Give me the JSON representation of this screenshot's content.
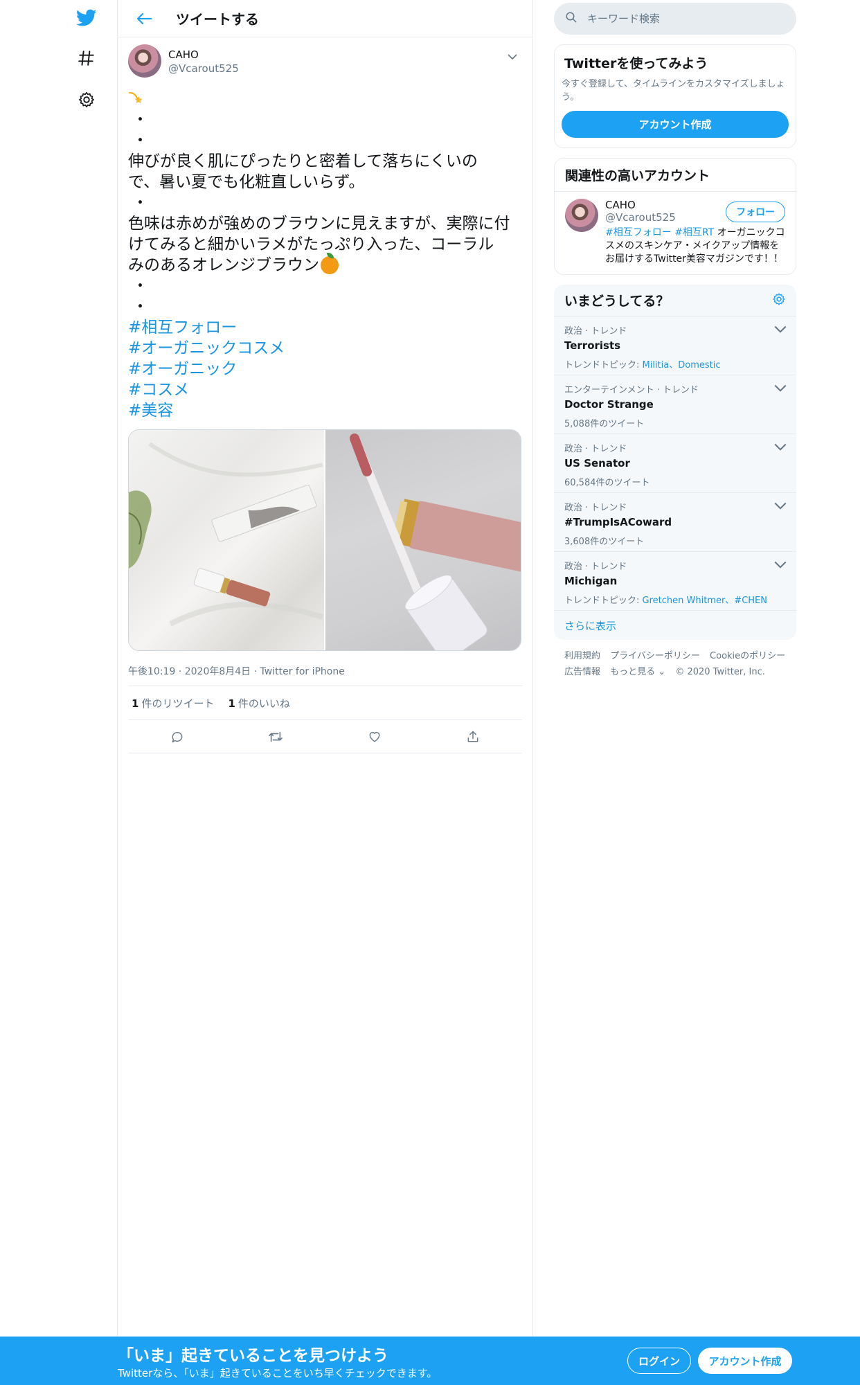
{
  "colors": {
    "brand": "#1da1f2",
    "link": "#1b95e0",
    "muted": "#657786",
    "text": "#14171a",
    "border": "#e6ecf0"
  },
  "nav": {
    "icons": [
      "twitter-logo-icon",
      "hashtag-icon",
      "gear-icon"
    ]
  },
  "header": {
    "title": "ツイートする"
  },
  "tweet": {
    "author_name": "CAHO",
    "author_handle": "@Vcarout525",
    "dot": "・",
    "line1": "伸びが良く肌にぴったりと密着して落ちにくいの",
    "line2": "で、暑い夏でも化粧直しいらず。",
    "line3": "色味は赤めが強めのブラウンに見えますが、実際に付",
    "line4": "けてみると細かいラメがたっぷり入った、コーラル",
    "line5": "みのあるオレンジブラウン",
    "hashtags": [
      "#相互フォロー",
      "#オーガニックコスメ",
      "#オーガニック",
      "#コスメ",
      "#美容"
    ],
    "meta_time": "午後10:19",
    "meta_date": "2020年8月4日",
    "meta_source": "Twitter for iPhone",
    "meta_sep": "·",
    "retweet_count": "1",
    "retweet_label": "件のリツイート",
    "like_count": "1",
    "like_label": "件のいいね"
  },
  "sidebar": {
    "search_placeholder": "キーワード検索",
    "signup": {
      "title": "Twitterを使ってみよう",
      "desc": "今すぐ登録して、タイムラインをカスタマイズしましょう。",
      "button": "アカウント作成"
    },
    "related": {
      "title": "関連性の高いアカウント",
      "name": "CAHO",
      "handle": "@Vcarout525",
      "follow": "フォロー",
      "bio_tag1": "#相互フォロー",
      "bio_tag2": "#相互RT",
      "bio_text": " オーガニックコスメのスキンケア・メイクアップ情報をお届けするTwitter美容マガジンです！！"
    },
    "trends": {
      "title": "いまどうしてる？",
      "items": [
        {
          "category": "政治 · トレンド",
          "name": "Terrorists",
          "sub_prefix": "トレンドトピック: ",
          "links": "Militia、Domestic",
          "count": ""
        },
        {
          "category": "エンターテインメント · トレンド",
          "name": "Doctor Strange",
          "sub_prefix": "",
          "links": "",
          "count": "5,088件のツイート"
        },
        {
          "category": "政治 · トレンド",
          "name": "US Senator",
          "sub_prefix": "",
          "links": "",
          "count": "60,584件のツイート"
        },
        {
          "category": "政治 · トレンド",
          "name": "#TrumpIsACoward",
          "sub_prefix": "",
          "links": "",
          "count": "3,608件のツイート"
        },
        {
          "category": "政治 · トレンド",
          "name": "Michigan",
          "sub_prefix": "トレンドトピック: ",
          "links": "Gretchen Whitmer、#CHEN",
          "count": ""
        }
      ],
      "show_more": "さらに表示"
    },
    "footer": {
      "terms": "利用規約",
      "privacy": "プライバシーポリシー",
      "cookies": "Cookieのポリシー",
      "ads": "広告情報",
      "more": "もっと見る ⌄",
      "copyright": "© 2020 Twitter, Inc."
    }
  },
  "bottom_bar": {
    "title": "「いま」起きていることを見つけよう",
    "subtitle": "Twitterなら、「いま」起きていることをいち早くチェックできます。",
    "login": "ログイン",
    "signup": "アカウント作成"
  }
}
